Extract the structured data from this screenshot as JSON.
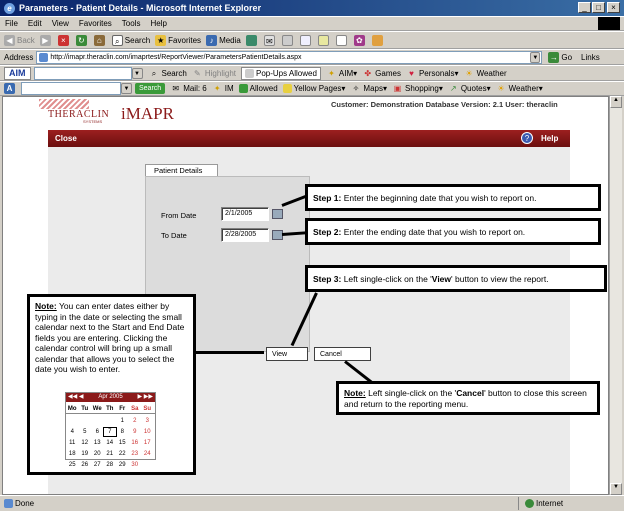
{
  "window": {
    "title": "Parameters - Patient Details - Microsoft Internet Explorer"
  },
  "menubar": [
    "File",
    "Edit",
    "View",
    "Favorites",
    "Tools",
    "Help"
  ],
  "toolbar": {
    "back": "Back",
    "search": "Search",
    "favorites": "Favorites",
    "media": "Media"
  },
  "address": {
    "label": "Address",
    "url": "http://imapr.theraclin.com/imaprtest/ReportViewer/ParametersPatientDetails.aspx",
    "go": "Go",
    "links": "Links"
  },
  "aim_toolbar": {
    "brand": "AIM",
    "search": "Search",
    "highlight": "Highlight",
    "popups": "Pop-Ups Allowed",
    "aim": "AIM",
    "games": "Games",
    "personals": "Personals",
    "weather": "Weather"
  },
  "search_toolbar": {
    "search_btn": "Search",
    "mail": "Mail: 6",
    "im": "IM",
    "allowed": "Allowed",
    "yellow_pages": "Yellow Pages",
    "maps": "Maps",
    "shopping": "Shopping",
    "quotes": "Quotes",
    "weather": "Weather"
  },
  "app": {
    "logo_left": "THERACLIN",
    "logo_sub": "SYSTEMS",
    "logo_right": "iMAPR",
    "customer_info": "Customer: Demonstration Database Version: 2.1 User: theraclin",
    "close": "Close",
    "help": "Help",
    "tab": "Patient Details",
    "from_label": "From Date",
    "from_value": "2/1/2005",
    "to_label": "To Date",
    "to_value": "2/28/2005",
    "view_btn": "View",
    "cancel_btn": "Cancel"
  },
  "callouts": {
    "step1_head": "Step 1:",
    "step1_text": " Enter the beginning date that you wish to report on.",
    "step2_head": "Step 2:",
    "step2_text": " Enter the ending date that you wish to report on.",
    "step3_head": "Step 3:",
    "step3_pre": " Left single-click on the '",
    "step3_bold": "View",
    "step3_post": "' button to view the report.",
    "note_left_head": "Note:",
    "note_left_text": " You can enter dates either by typing in the date or selecting the small calendar next to the Start and End Date fields you are entering. Clicking the calendar control will bring up a small calendar that allows you to select the date you wish to enter.",
    "note_right_head": "Note:",
    "note_right_pre": " Left single-click on the '",
    "note_right_bold": "Cancel",
    "note_right_post": "' button to close this screen and return to the reporting menu."
  },
  "calendar": {
    "month": "Apr 2005",
    "days": [
      "Mo",
      "Tu",
      "We",
      "Th",
      "Fr",
      "Sa",
      "Su"
    ],
    "weeks": [
      [
        "",
        "",
        "",
        "",
        "1",
        "2",
        "3"
      ],
      [
        "4",
        "5",
        "6",
        "7",
        "8",
        "9",
        "10"
      ],
      [
        "11",
        "12",
        "13",
        "14",
        "15",
        "16",
        "17"
      ],
      [
        "18",
        "19",
        "20",
        "21",
        "22",
        "23",
        "24"
      ],
      [
        "25",
        "26",
        "27",
        "28",
        "29",
        "30",
        ""
      ]
    ]
  },
  "status": {
    "left": "Done",
    "zone": "Internet"
  },
  "colors": {
    "title_bar": "#0a246a",
    "app_red": "#8b1a1a",
    "callout_border": "#000000"
  }
}
